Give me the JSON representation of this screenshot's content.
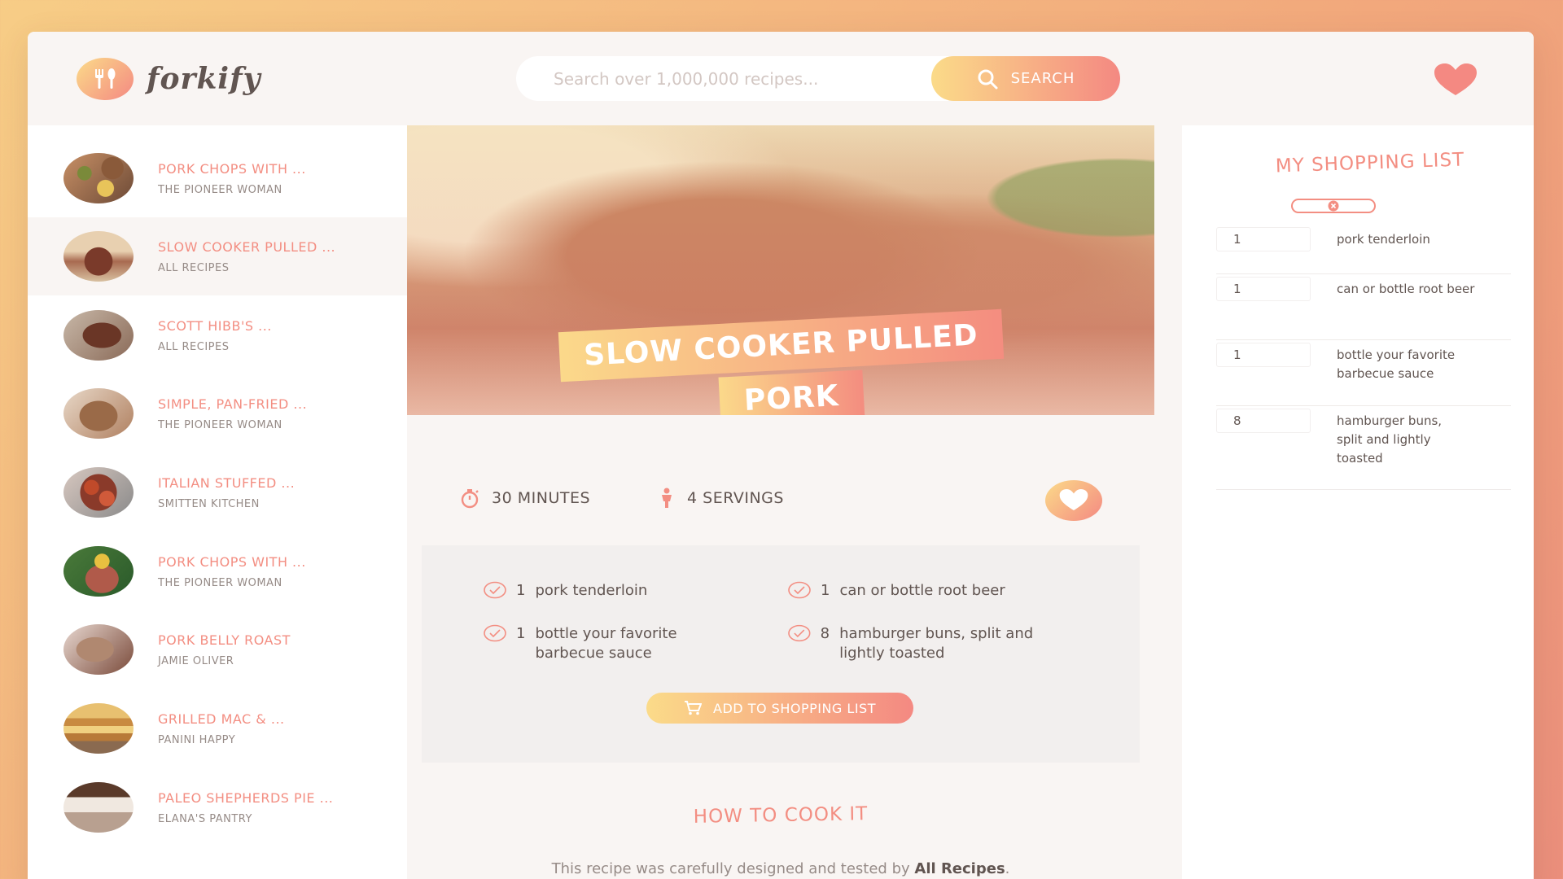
{
  "app": {
    "logo_text": "forkify"
  },
  "search": {
    "placeholder": "Search over 1,000,000 recipes...",
    "button_label": "SEARCH"
  },
  "results": [
    {
      "title": "PORK CHOPS WITH ...",
      "author": "THE PIONEER WOMAN"
    },
    {
      "title": "SLOW COOKER PULLED ...",
      "author": "ALL RECIPES"
    },
    {
      "title": "SCOTT HIBB'S ...",
      "author": "ALL RECIPES"
    },
    {
      "title": "SIMPLE, PAN-FRIED ...",
      "author": "THE PIONEER WOMAN"
    },
    {
      "title": "ITALIAN STUFFED ...",
      "author": "SMITTEN KITCHEN"
    },
    {
      "title": "PORK CHOPS WITH ...",
      "author": "THE PIONEER WOMAN"
    },
    {
      "title": "PORK BELLY ROAST",
      "author": "JAMIE OLIVER"
    },
    {
      "title": "GRILLED MAC & ...",
      "author": "PANINI HAPPY"
    },
    {
      "title": "PALEO SHEPHERDS PIE ...",
      "author": "ELANA'S PANTRY"
    }
  ],
  "recipe": {
    "title_line1": "SLOW COOKER PULLED",
    "title_line2": "PORK",
    "minutes": "30",
    "minutes_label": "MINUTES",
    "servings": "4",
    "servings_label": "SERVINGS",
    "ingredients": [
      {
        "count": "1",
        "text": "pork tenderloin"
      },
      {
        "count": "1",
        "text": "can or bottle root beer"
      },
      {
        "count": "1",
        "text": "bottle your favorite barbecue sauce"
      },
      {
        "count": "8",
        "text": "hamburger buns, split and lightly toasted"
      }
    ],
    "add_button_label": "ADD TO SHOPPING LIST",
    "directions_heading": "HOW TO COOK IT",
    "directions_text": "This recipe was carefully designed and tested by",
    "directions_publisher": "All Recipes",
    "directions_end": "."
  },
  "shopping": {
    "title": "MY SHOPPING LIST",
    "items": [
      {
        "qty": "1",
        "desc": "pork tenderloin"
      },
      {
        "qty": "1",
        "desc": "can or bottle root beer"
      },
      {
        "qty": "1",
        "desc": "bottle your favorite barbecue sauce"
      },
      {
        "qty": "8",
        "desc": "hamburger buns, split and lightly toasted"
      }
    ]
  },
  "colors": {
    "accent": "#f38e82",
    "gradient_start": "#fbdb89",
    "gradient_end": "#f48982",
    "text": "#615551"
  },
  "icons": {
    "logo": "fork-knife-icon",
    "search": "search-icon",
    "bookmarks": "heart-icon",
    "time": "stopwatch-icon",
    "servings": "person-icon",
    "check": "check-circle-icon",
    "cart": "cart-icon",
    "clear": "x-circle-icon"
  }
}
